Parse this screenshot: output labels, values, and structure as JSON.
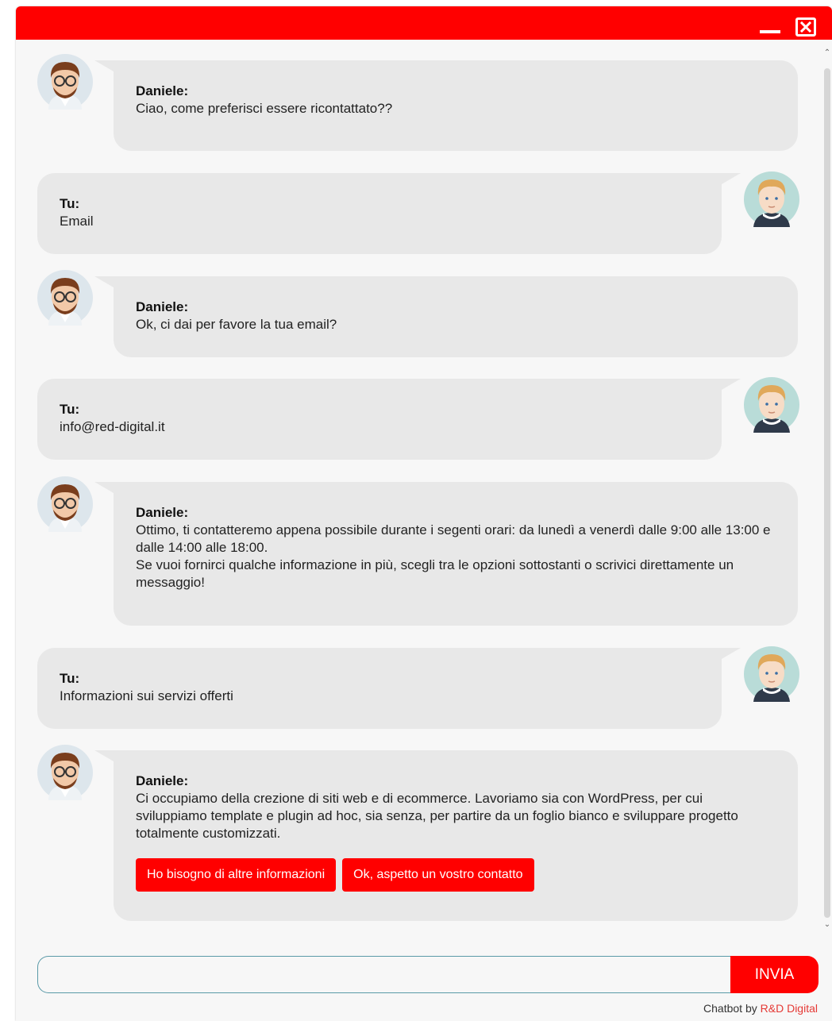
{
  "window": {
    "colors": {
      "titlebar": "#ff0000",
      "bubble": "#e8e8e8",
      "accent": "#ff0000",
      "link": "#e53935"
    },
    "icons": {
      "minimize": "minimize-icon",
      "close": "close-icon"
    }
  },
  "chat": {
    "bot_avatar_icon": "bot-avatar-icon",
    "user_avatar_icon": "user-avatar-icon",
    "messages": [
      {
        "role": "bot",
        "sender": "Daniele:",
        "text": "Ciao, come preferisci essere ricontattato??"
      },
      {
        "role": "user",
        "sender": "Tu:",
        "text": "Email"
      },
      {
        "role": "bot",
        "sender": "Daniele:",
        "text": "Ok, ci dai per favore la tua email?"
      },
      {
        "role": "user",
        "sender": "Tu:",
        "text": "info@red-digital.it"
      },
      {
        "role": "bot",
        "sender": "Daniele:",
        "text": "Ottimo, ti contatteremo appena possibile durante i segenti orari: da lunedì a venerdì dalle 9:00 alle 13:00 e dalle 14:00 alle 18:00.\nSe vuoi fornirci qualche informazione in più, scegli tra le opzioni sottostanti o scrivici direttamente un messaggio!"
      },
      {
        "role": "user",
        "sender": "Tu:",
        "text": "Informazioni sui servizi offerti"
      },
      {
        "role": "bot",
        "sender": "Daniele:",
        "text": "Ci occupiamo della crezione di siti web e di ecommerce. Lavoriamo sia con WordPress, per cui sviluppiamo template e plugin ad hoc, sia senza, per partire da un foglio bianco e sviluppare progetto totalmente customizzati.",
        "actions": [
          "Ho bisogno di altre informazioni",
          "Ok, aspetto un vostro contatto"
        ]
      }
    ]
  },
  "composer": {
    "input_value": "",
    "send_label": "INVIA"
  },
  "footer": {
    "prefix": "Chatbot by ",
    "link": "R&D Digital"
  }
}
